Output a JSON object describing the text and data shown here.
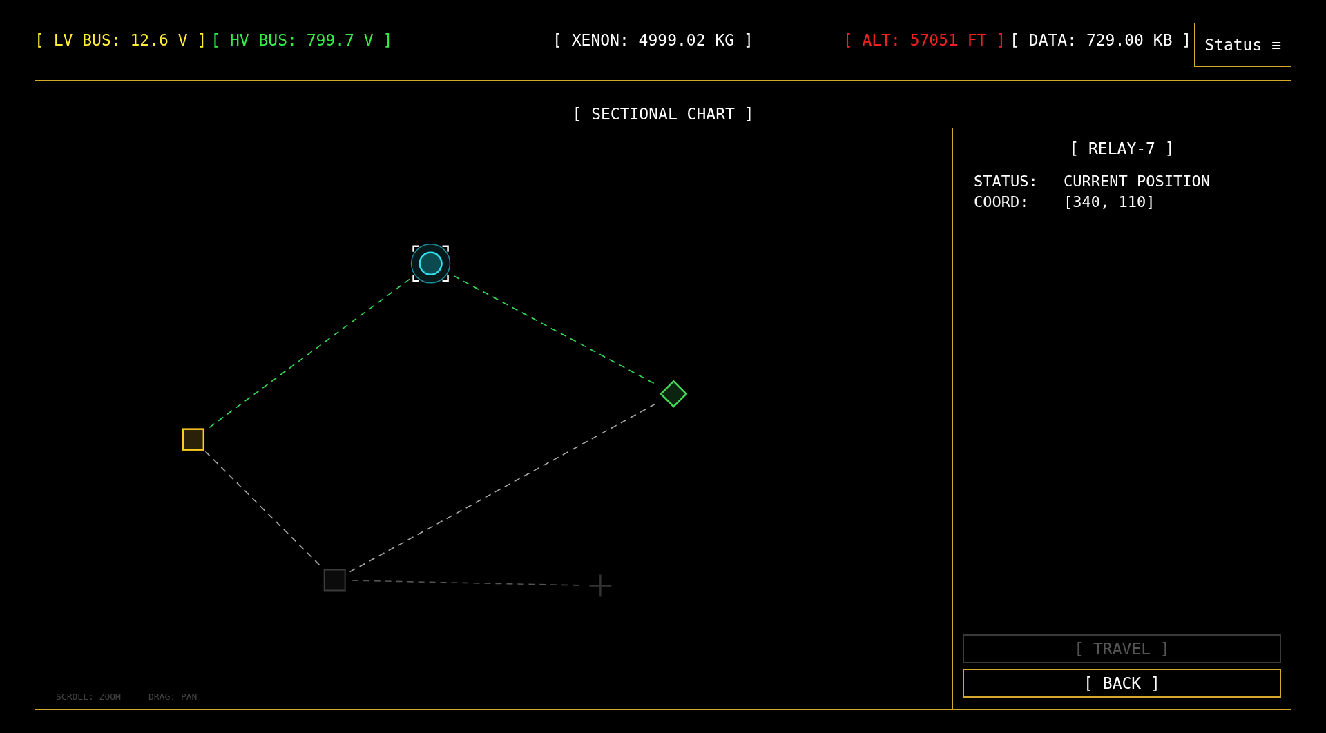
{
  "top_bar": {
    "readings": [
      {
        "text": "[ LV BUS: 12.6 V ]",
        "color": "#ffee33"
      },
      {
        "text": "[ HV BUS: 799.7 V ]",
        "color": "#33ee44"
      },
      {
        "text": "[ XENON: 4999.02 KG ]",
        "color": "#ffffff"
      },
      {
        "text": "[ ALT: 57051 FT ]",
        "color": "#ee2222"
      },
      {
        "text": "[ DATA: 729.00 KB ]",
        "color": "#ffffff"
      }
    ],
    "status_button": "Status ≡"
  },
  "map": {
    "title": "[ SECTIONAL CHART ]",
    "nodes": [
      {
        "kind": "relay",
        "selected": true
      },
      {
        "kind": "outpost",
        "selected": false
      },
      {
        "kind": "beacon",
        "selected": false
      },
      {
        "kind": "unknown",
        "selected": false
      },
      {
        "kind": "cursor",
        "selected": false
      }
    ],
    "hints": [
      "SCROLL: ZOOM",
      "DRAG: PAN"
    ]
  },
  "panel": {
    "title": "[ RELAY-7 ]",
    "fields": [
      {
        "label": "STATUS:",
        "value": "CURRENT POSITION"
      },
      {
        "label": "COORD:",
        "value": "[340, 110]"
      }
    ],
    "buttons": [
      {
        "label": "[ TRAVEL ]",
        "disabled": true
      },
      {
        "label": "[ BACK ]",
        "disabled": false
      }
    ]
  }
}
